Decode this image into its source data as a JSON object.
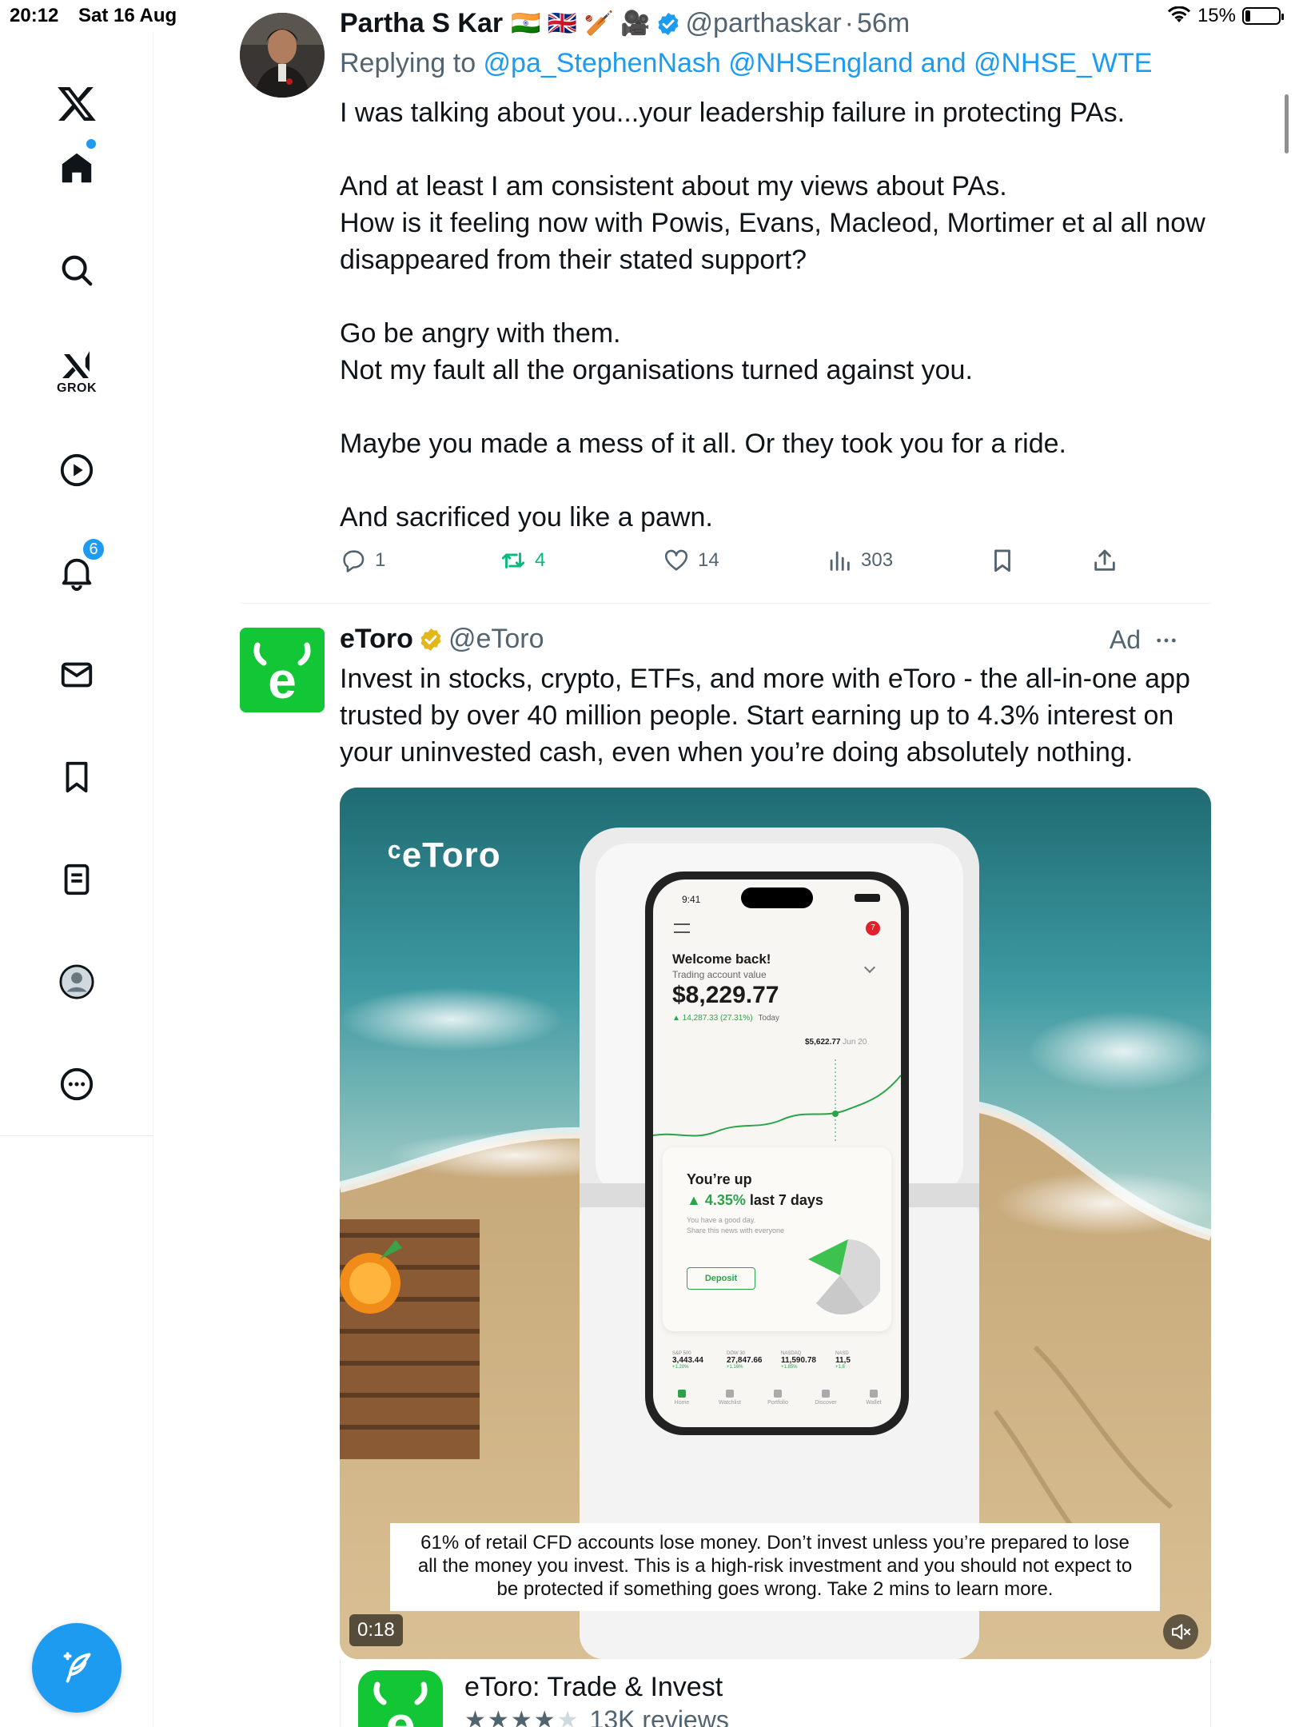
{
  "status_bar": {
    "time": "20:12",
    "date": "Sat 16 Aug",
    "battery": "15%",
    "battery_level": 0.15
  },
  "sidebar": {
    "items": [
      {
        "id": "x-logo",
        "icon": "x-logo-icon"
      },
      {
        "id": "home",
        "icon": "home-icon",
        "has_dot": true
      },
      {
        "id": "search",
        "icon": "search-icon"
      },
      {
        "id": "grok",
        "icon": "grok-icon",
        "label": "GROK"
      },
      {
        "id": "video",
        "icon": "play-icon"
      },
      {
        "id": "notifications",
        "icon": "bell-icon",
        "badge": "6"
      },
      {
        "id": "messages",
        "icon": "mail-icon"
      },
      {
        "id": "bookmarks",
        "icon": "bookmark-icon"
      },
      {
        "id": "lists",
        "icon": "list-icon"
      },
      {
        "id": "profile",
        "icon": "profile-icon"
      },
      {
        "id": "more",
        "icon": "more-icon"
      }
    ],
    "compose": {
      "icon": "compose-icon"
    }
  },
  "tweet1": {
    "name": "Partha S Kar",
    "emojis": "🇮🇳 🇬🇧 🏏 🎥",
    "handle": "@parthaskar",
    "dot": "·",
    "time": "56m",
    "replying_prefix": "Replying to ",
    "replying_mentions": "@pa_StephenNash @NHSEngland and @NHSE_WTE",
    "text": "I was talking about you...your leadership failure in protecting PAs.\n\nAnd at least I am consistent about my views about PAs.\nHow is it feeling now with Powis, Evans, Macleod, Mortimer et al all now disappeared from their stated support?\n\nGo be angry with them.\nNot my fault all the organisations turned against you.\n\nMaybe you made a mess of it all. Or they took you for a ride.\n\nAnd sacrificed you like a pawn.",
    "actions": {
      "replies": "1",
      "reposts": "4",
      "likes": "14",
      "views": "303"
    }
  },
  "ad": {
    "name": "eToro",
    "handle": "@eToro",
    "ad_label": "Ad",
    "text": "Invest in stocks, crypto, ETFs, and more with eToro - the all-in-one app trusted by over 40 million people. Start earning up to 4.3% interest on your uninvested cash, even when you’re doing absolutely nothing.",
    "video": {
      "brand": "ᶜeToro",
      "duration": "0:18",
      "disclaimer": "61% of retail CFD accounts lose money. Don’t invest unless you’re prepared to lose all the money you invest. This is a high-risk investment and you should not expect to be protected if something goes wrong. Take 2 mins to learn more.",
      "phone": {
        "time": "9:41",
        "notif": "7",
        "welcome": "Welcome back!",
        "subtitle": "Trading account value",
        "value": "$8,229.77",
        "change": "▲ 14,287.33 (27.31%)",
        "today": "Today",
        "tooltip": "$5,622.77",
        "tooltip_date": "Jun 20",
        "up_title": "You’re up",
        "up_pct": "▲ 4.35%",
        "up_suffix": " last 7 days",
        "good_day": "You have a good day.",
        "share_line": "Share this news with everyone",
        "deposit": "Deposit",
        "tickers": [
          {
            "name": "S&P 500",
            "value": "3,443.44",
            "chg": "+1.20%"
          },
          {
            "name": "DOW 30",
            "value": "27,847.66",
            "chg": "+1.16%"
          },
          {
            "name": "NASDAQ",
            "value": "11,590.78",
            "chg": "+1.85%"
          },
          {
            "name": "NASD",
            "value": "11,5",
            "chg": "+1.8"
          }
        ],
        "tabs": [
          "Home",
          "Watchlist",
          "Portfolio",
          "Discover",
          "Wallet"
        ]
      }
    },
    "app_card": {
      "name": "eToro: Trade & Invest",
      "stars_filled": 4,
      "stars_total": 5,
      "reviews": "13K reviews"
    }
  },
  "colors": {
    "accent": "#1d9bf0",
    "repost_green": "#00ba7c",
    "etoro_green": "#13c636",
    "text": "#0f1419",
    "muted": "#536471"
  }
}
